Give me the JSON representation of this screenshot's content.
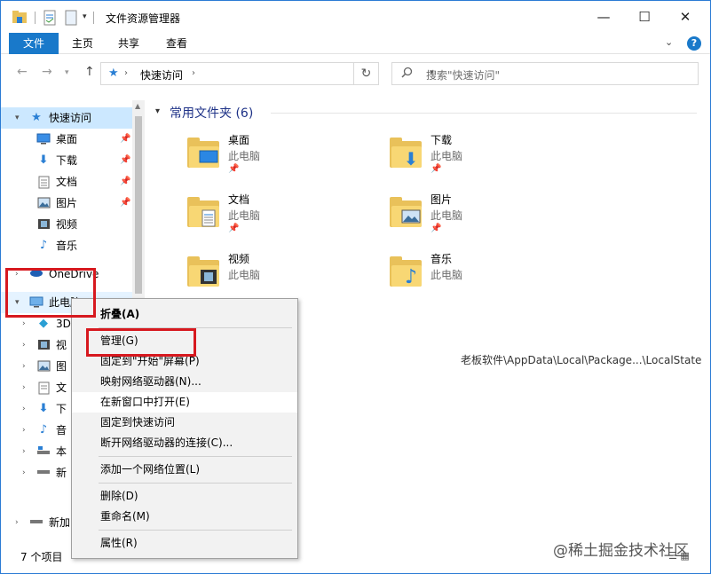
{
  "window": {
    "title": "文件资源管理器",
    "controls": {
      "minimize": "—",
      "maximize": "☐",
      "close": "✕"
    }
  },
  "ribbon": {
    "tabs": [
      "文件",
      "主页",
      "共享",
      "查看"
    ],
    "collapse_glyph": "⌄",
    "help_glyph": "?"
  },
  "address": {
    "current": "快速访问",
    "separator": "›",
    "search_placeholder": "搜索\"快速访问\""
  },
  "sidebar": {
    "quick_access": "快速访问",
    "pinned": [
      "桌面",
      "下载",
      "文档",
      "图片"
    ],
    "unpinned": [
      "视频",
      "音乐"
    ],
    "onedrive": "OneDrive",
    "this_pc": "此电脑",
    "pc_children": [
      "3D",
      "视",
      "图",
      "文",
      "下",
      "音",
      "本",
      "新"
    ],
    "extra_drive": "新加",
    "pin_glyph": "📌"
  },
  "content": {
    "group_title": "常用文件夹 (6)",
    "folders": [
      {
        "name": "桌面",
        "location": "此电脑",
        "pinned": true,
        "icon": "desktop-icon"
      },
      {
        "name": "下载",
        "location": "此电脑",
        "pinned": true,
        "icon": "download-arrow-icon"
      },
      {
        "name": "文档",
        "location": "此电脑",
        "pinned": true,
        "icon": "document-icon"
      },
      {
        "name": "图片",
        "location": "此电脑",
        "pinned": true,
        "icon": "picture-icon"
      },
      {
        "name": "视频",
        "location": "此电脑",
        "pinned": false,
        "icon": "film-icon"
      },
      {
        "name": "音乐",
        "location": "此电脑",
        "pinned": false,
        "icon": "music-note-icon"
      }
    ],
    "recent_path": "老板软件\\AppData\\Local\\Package...\\LocalState"
  },
  "context_menu": {
    "items": [
      "折叠(A)",
      "管理(G)",
      "固定到\"开始\"屏幕(P)",
      "映射网络驱动器(N)...",
      "在新窗口中打开(E)",
      "固定到快速访问",
      "断开网络驱动器的连接(C)...",
      "添加一个网络位置(L)",
      "删除(D)",
      "重命名(M)",
      "属性(R)"
    ]
  },
  "status": {
    "item_count": "7 个项目"
  },
  "watermark": "@稀土掘金技术社区",
  "colors": {
    "accent": "#1979ca",
    "highlight_box": "#d7191f",
    "selection": "#cce8ff"
  }
}
